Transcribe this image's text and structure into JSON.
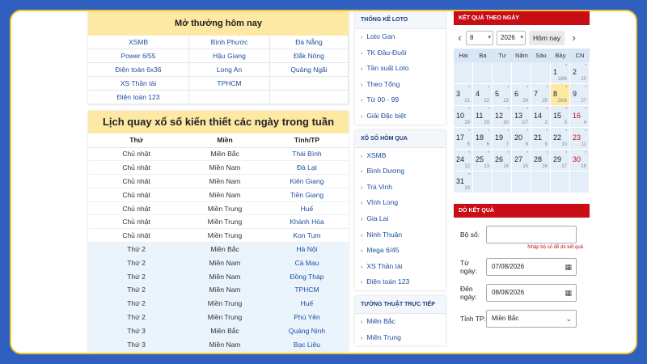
{
  "today": {
    "title": "Mở thưởng hôm nay",
    "rows": [
      [
        "XSMB",
        "Bình Phước",
        "Đà Nẵng"
      ],
      [
        "Power 6/55",
        "Hậu Giang",
        "Đắk Nông"
      ],
      [
        "Điện toán 6x36",
        "Long An",
        "Quảng Ngãi"
      ],
      [
        "XS Thần tài",
        "TPHCM",
        ""
      ],
      [
        "Điện toán 123",
        "",
        ""
      ]
    ]
  },
  "schedule": {
    "title": "Lịch quay xổ số kiến thiết các ngày trong tuần",
    "headers": [
      "Thứ",
      "Miền",
      "Tỉnh/TP"
    ],
    "rows": [
      [
        "Chủ nhật",
        "Miền Bắc",
        "Thái Bình"
      ],
      [
        "Chủ nhật",
        "Miền Nam",
        "Đà Lạt"
      ],
      [
        "Chủ nhật",
        "Miền Nam",
        "Kiên Giang"
      ],
      [
        "Chủ nhật",
        "Miền Nam",
        "Tiền Giang"
      ],
      [
        "Chủ nhật",
        "Miền Trung",
        "Huế"
      ],
      [
        "Chủ nhật",
        "Miền Trung",
        "Khánh Hòa"
      ],
      [
        "Chủ nhật",
        "Miền Trung",
        "Kon Tum"
      ],
      [
        "Thứ 2",
        "Miền Bắc",
        "Hà Nội"
      ],
      [
        "Thứ 2",
        "Miền Nam",
        "Cà Mau"
      ],
      [
        "Thứ 2",
        "Miền Nam",
        "Đồng Tháp"
      ],
      [
        "Thứ 2",
        "Miền Nam",
        "TPHCM"
      ],
      [
        "Thứ 2",
        "Miền Trung",
        "Huế"
      ],
      [
        "Thứ 2",
        "Miền Trung",
        "Phú Yên"
      ],
      [
        "Thứ 3",
        "Miền Bắc",
        "Quảng Ninh"
      ],
      [
        "Thứ 3",
        "Miền Nam",
        "Bạc Liêu"
      ]
    ]
  },
  "loto_stats": {
    "title": "THỐNG KÊ LOTO",
    "items": [
      "Loto Gan",
      "TK Đầu-Đuôi",
      "Tần suất Loto",
      "Theo Tổng",
      "Từ 00 - 99",
      "Giải Đặc biệt"
    ]
  },
  "yesterday": {
    "title": "XỔ SỐ HÔM QUA",
    "items": [
      "XSMB",
      "Bình Dương",
      "Trà Vinh",
      "Vĩnh Long",
      "Gia Lai",
      "Ninh Thuận",
      "Mega 6/45",
      "XS Thần tài",
      "Điện toán 123"
    ]
  },
  "live": {
    "title": "TƯỜNG THUẬT TRỰC TIẾP",
    "items": [
      "Miền Bắc",
      "Miền Trung"
    ]
  },
  "calendar": {
    "title": "KẾT QUẢ THEO NGÀY",
    "month": "8",
    "year": "2026",
    "today_button": "Hôm nay",
    "weekdays": [
      "Hai",
      "Ba",
      "Tư",
      "Năm",
      "Sáu",
      "Bảy",
      "CN"
    ],
    "weeks": [
      [
        null,
        null,
        null,
        null,
        null,
        {
          "d": "1",
          "lm": "19/6"
        },
        {
          "d": "2",
          "lm": "20"
        }
      ],
      [
        {
          "d": "3",
          "lm": "21"
        },
        {
          "d": "4",
          "lm": "22"
        },
        {
          "d": "5",
          "lm": "23"
        },
        {
          "d": "6",
          "lm": "24"
        },
        {
          "d": "7",
          "lm": "25"
        },
        {
          "d": "8",
          "lm": "26/6",
          "today": true
        },
        {
          "d": "9",
          "lm": "27"
        }
      ],
      [
        {
          "d": "10",
          "lm": "28"
        },
        {
          "d": "11",
          "lm": "29"
        },
        {
          "d": "12",
          "lm": "30"
        },
        {
          "d": "13",
          "lm": "1/7"
        },
        {
          "d": "14",
          "lm": "2"
        },
        {
          "d": "15",
          "lm": "3"
        },
        {
          "d": "16",
          "lm": "4",
          "red": true
        }
      ],
      [
        {
          "d": "17",
          "lm": "5"
        },
        {
          "d": "18",
          "lm": "6"
        },
        {
          "d": "19",
          "lm": "7"
        },
        {
          "d": "20",
          "lm": "8"
        },
        {
          "d": "21",
          "lm": "9"
        },
        {
          "d": "22",
          "lm": "10"
        },
        {
          "d": "23",
          "lm": "11",
          "red": true
        }
      ],
      [
        {
          "d": "24",
          "lm": "12"
        },
        {
          "d": "25",
          "lm": "13"
        },
        {
          "d": "26",
          "lm": "14"
        },
        {
          "d": "27",
          "lm": "15"
        },
        {
          "d": "28",
          "lm": "16"
        },
        {
          "d": "29",
          "lm": "17"
        },
        {
          "d": "30",
          "lm": "18",
          "red": true
        }
      ],
      [
        {
          "d": "31",
          "lm": "19"
        },
        null,
        null,
        null,
        null,
        null,
        null
      ]
    ]
  },
  "check": {
    "title": "DÒ KẾT QUẢ",
    "ticket_label": "Bộ số:",
    "ticket_value": "",
    "hint": "Nhập bộ số để dò kết quả",
    "from_label": "Từ ngày:",
    "from_value": "07/08/2026",
    "to_label": "Đến ngày:",
    "to_value": "08/08/2026",
    "province_label": "Tỉnh TP:",
    "province_value": "Miền Bắc"
  },
  "colors": {
    "background": "#2f5fbf",
    "frame_border": "#f2c531",
    "header_yellow": "#fde9a3",
    "red": "#c90d17",
    "link_blue": "#1d4e9e",
    "row_alt": "#eaf4fd"
  }
}
